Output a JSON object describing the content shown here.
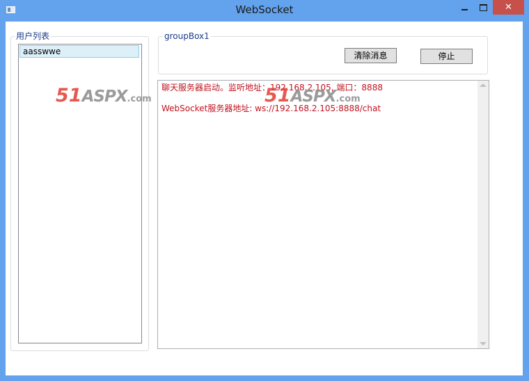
{
  "window": {
    "title": "WebSocket",
    "close_label": "✕"
  },
  "user_group": {
    "label": "用户列表",
    "users": [
      "aasswwe"
    ]
  },
  "control_group": {
    "label": "groupBox1",
    "clear_button": "清除消息",
    "stop_button": "停止"
  },
  "log": {
    "lines": [
      "聊天服务器启动。监听地址：192.168.2.105, 端口：8888",
      "WebSocket服务器地址: ws://192.168.2.105:8888/chat"
    ]
  },
  "watermark": {
    "num": "51",
    "brand": "ASPX",
    "suffix": ".com"
  },
  "colors": {
    "titlebar": "#63a3ee",
    "close_button": "#c7504b",
    "log_text": "#c1121f",
    "selected_item": "#ddf0fa",
    "group_label": "#1e3c8c"
  }
}
